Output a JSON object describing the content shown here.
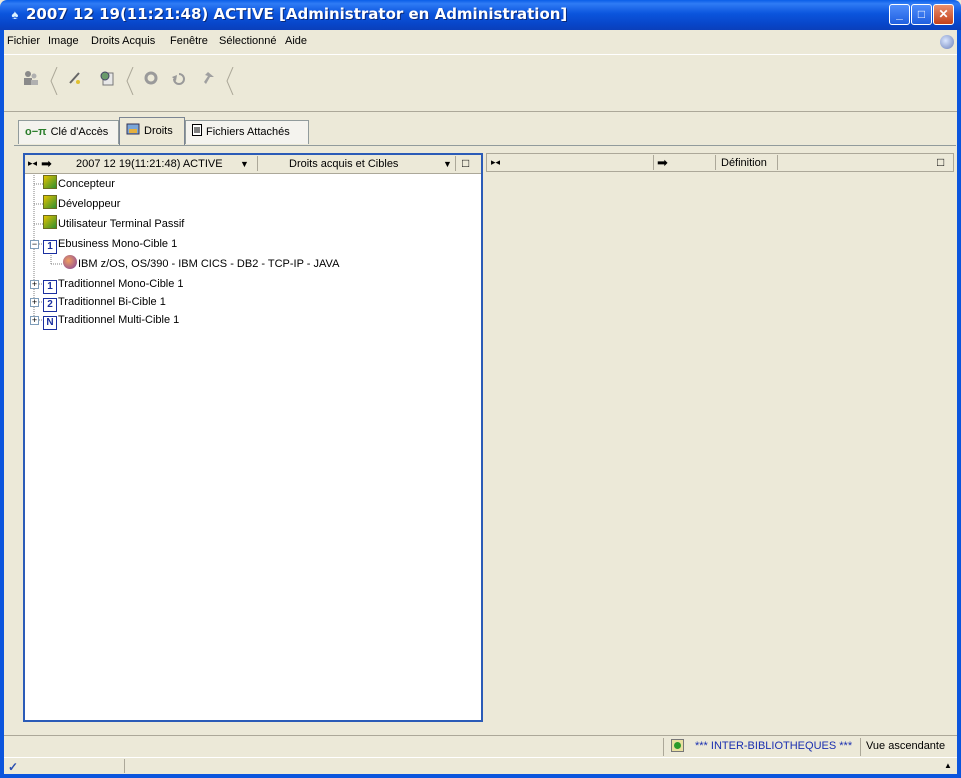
{
  "window": {
    "title": "2007 12 19(11:21:48) ACTIVE [Administrator en Administration]",
    "minimize": "_",
    "maximize": "□",
    "close": "✕"
  },
  "menu": {
    "items": [
      "Fichier",
      "Image",
      "Droits Acquis",
      "Fenêtre",
      "Sélectionné",
      "Aide"
    ]
  },
  "toolbar": {
    "buttons": [
      "users-icon",
      "pencil-icon",
      "page-globe-icon",
      "refresh-icon",
      "undo-icon",
      "arrow-up-icon"
    ]
  },
  "tabs": [
    {
      "label": "Clé d'Accès",
      "icon": "key-icon",
      "active": false
    },
    {
      "label": "Droits",
      "icon": "rights-icon",
      "active": true
    },
    {
      "label": "Fichiers Attachés",
      "icon": "document-icon",
      "active": false
    }
  ],
  "left_pane": {
    "header": {
      "date_selector": "2007 12 19(11:21:48) ACTIVE",
      "date_arrow": "▼",
      "view_selector": "Droits acquis et Cibles",
      "view_arrow": "▼"
    },
    "tree": [
      {
        "label": "Concepteur",
        "icon": "role-icon"
      },
      {
        "label": "Développeur",
        "icon": "role-icon"
      },
      {
        "label": "Utilisateur Terminal Passif",
        "icon": "role-icon"
      },
      {
        "label": "Ebusiness Mono-Cible 1",
        "icon": "mono-cible-icon",
        "badge": "1",
        "expanded": true
      },
      {
        "label": "IBM z/OS, OS/390 - IBM CICS - DB2 - TCP-IP - JAVA",
        "icon": "target-icon"
      },
      {
        "label": "Traditionnel Mono-Cible 1",
        "icon": "mono-cible-icon",
        "badge": "1"
      },
      {
        "label": "Traditionnel Bi-Cible 1",
        "icon": "bi-cible-icon",
        "badge": "2"
      },
      {
        "label": "Traditionnel Multi-Cible 1",
        "icon": "multi-cible-icon",
        "badge": "N"
      }
    ]
  },
  "right_pane": {
    "header": {
      "column": "Définition"
    }
  },
  "status": {
    "library": "*** INTER-BIBLIOTHEQUES ***",
    "view": "Vue ascendante"
  }
}
